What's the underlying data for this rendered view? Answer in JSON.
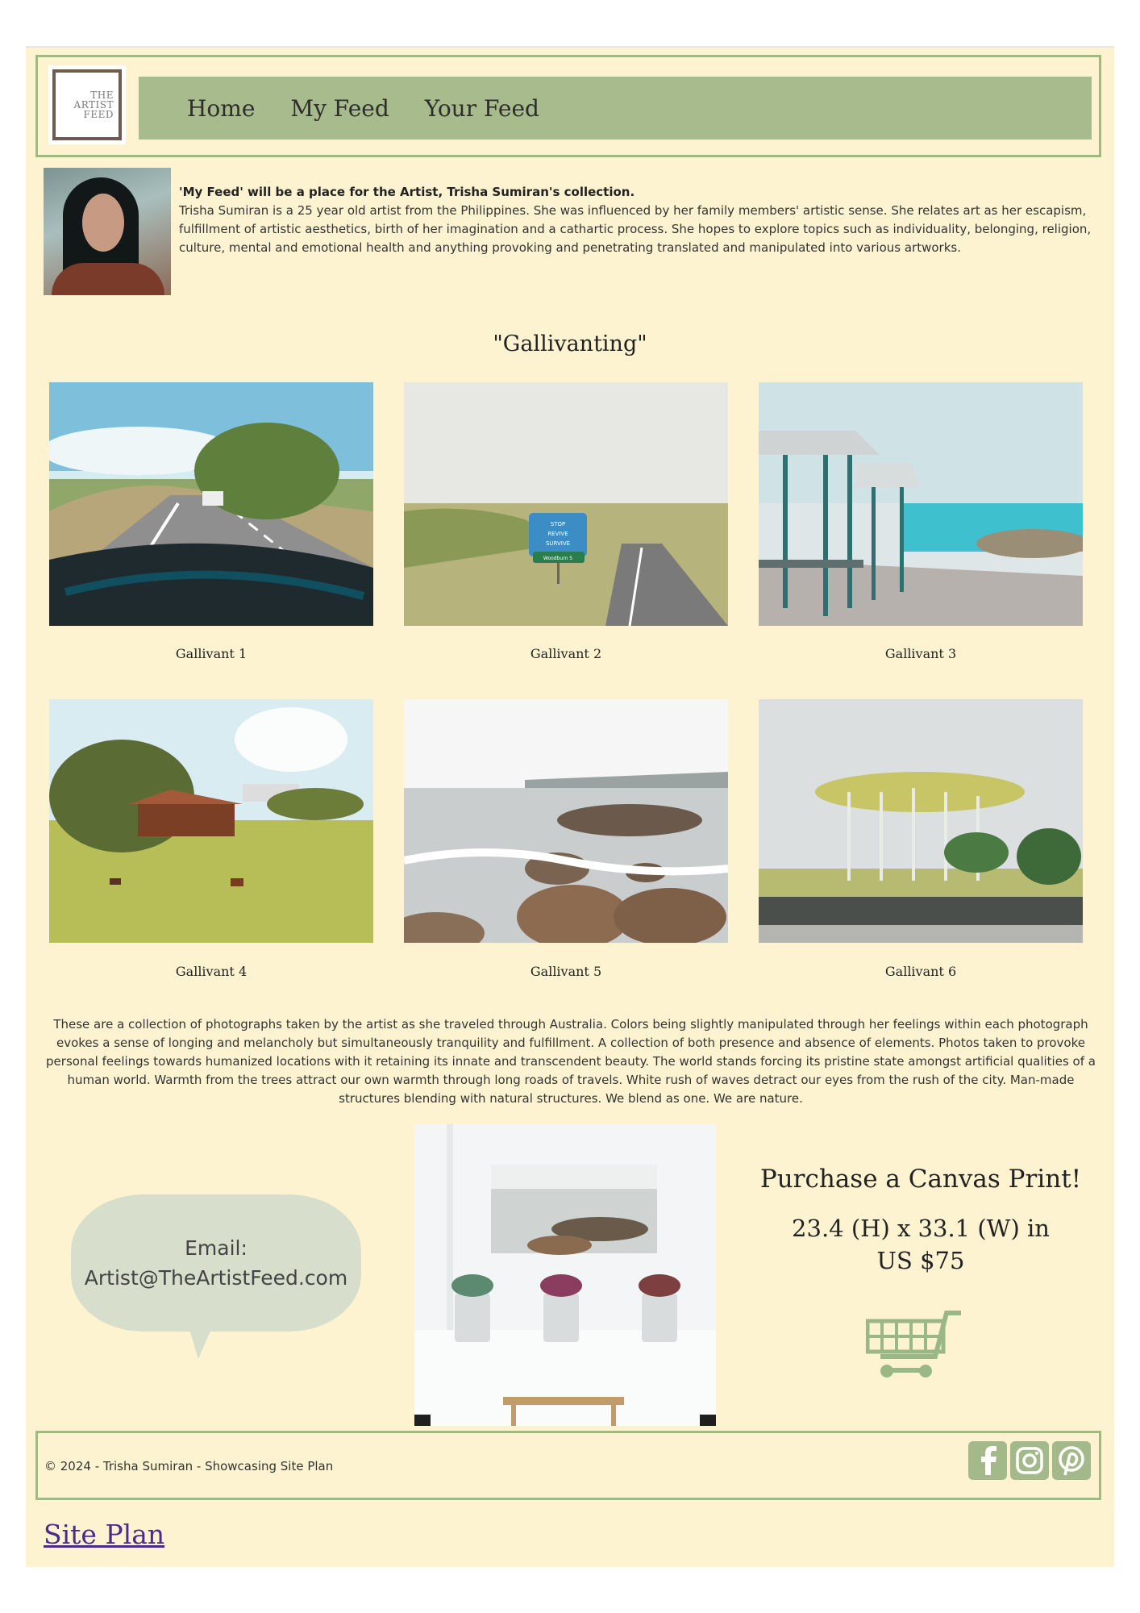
{
  "logo": {
    "lines": [
      "THE",
      "ARTIST",
      "FEED"
    ]
  },
  "nav": {
    "items": [
      "Home",
      "My Feed",
      "Your Feed"
    ]
  },
  "intro": {
    "title": "'My Feed' will be a place for the Artist, Trisha Sumiran's collection.",
    "text": "Trisha Sumiran is a 25 year old artist from the Philippines. She was influenced by her family members' artistic sense. She relates art as her escapism, fulfillment of artistic aesthetics, birth of her imagination and a cathartic process. She hopes to explore topics such as individuality, belonging, religion, culture, mental and emotional health and anything provoking and penetrating translated and manipulated into various artworks."
  },
  "gallery": {
    "title": "\"Gallivanting\"",
    "captions": [
      "Gallivant 1",
      "Gallivant 2",
      "Gallivant 3",
      "Gallivant 4",
      "Gallivant 5",
      "Gallivant 6"
    ],
    "sign_text": [
      "STOP",
      "REVIVE",
      "SURVIVE",
      "Woodburn 5"
    ],
    "description": "These are a collection of photographs taken by the artist as she traveled through Australia. Colors being slightly manipulated through her feelings within each photograph evokes a sense of longing and melancholy but simultaneously tranquility and fulfillment. A collection of both presence and absence of elements. Photos taken to provoke personal feelings towards humanized locations with it retaining its innate and transcendent beauty. The world stands forcing its pristine state amongst artificial qualities of a human world. Warmth from the trees attract our own warmth through long roads of travels. White rush of waves detract our eyes from the rush of the city. Man-made structures blending with natural structures. We blend as one. We are nature."
  },
  "contact": {
    "label": "Email:",
    "email": "Artist@TheArtistFeed.com"
  },
  "purchase": {
    "title": "Purchase a Canvas Print!",
    "size": "23.4 (H) x 33.1 (W) in",
    "price": "US $75"
  },
  "footer": {
    "copyright": "© 2024 - Trisha Sumiran - Showcasing Site Plan",
    "social": [
      "facebook-icon",
      "instagram-icon",
      "pinterest-icon"
    ]
  },
  "site_plan_link": "Site Plan",
  "colors": {
    "background": "#fdf3d0",
    "accent": "#a8bb8d",
    "border": "#9dbb7f",
    "link": "#4a2a8f"
  }
}
